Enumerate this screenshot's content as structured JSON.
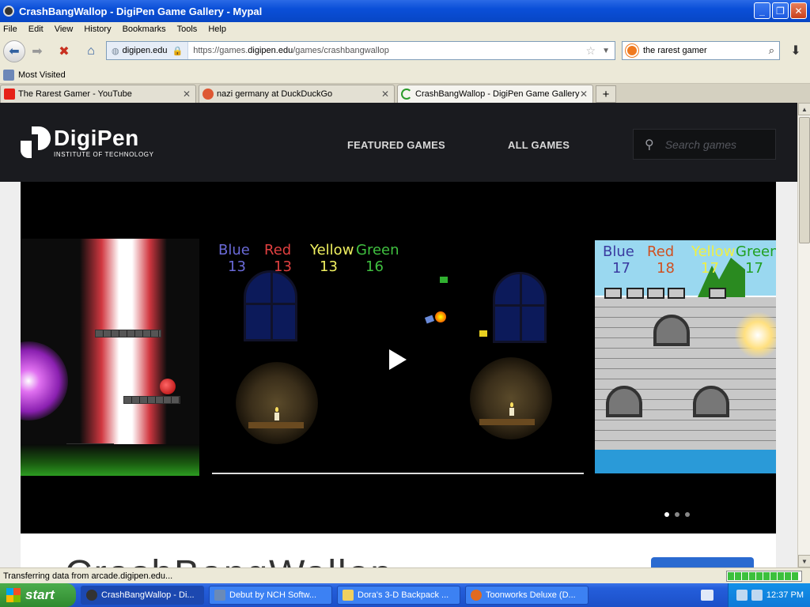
{
  "window": {
    "title": "CrashBangWallop - DigiPen Game Gallery - Mypal"
  },
  "menu": [
    "File",
    "Edit",
    "View",
    "History",
    "Bookmarks",
    "Tools",
    "Help"
  ],
  "nav": {
    "site": "digipen.edu",
    "url_prefix": "https://games.",
    "url_domain": "digipen.edu",
    "url_path": "/games/crashbangwallop",
    "search_value": "the rarest gamer"
  },
  "bookmarks": {
    "most_visited": "Most Visited"
  },
  "tabs": [
    {
      "label": "The Rarest Gamer - YouTube",
      "icon_color": "#e62117"
    },
    {
      "label": "nazi germany at DuckDuckGo",
      "icon_color": "#de5833"
    },
    {
      "label": "CrashBangWallop - DigiPen Game Gallery",
      "icon_color": "#2a9a2a"
    }
  ],
  "site": {
    "logo_main": "DigiPen",
    "logo_sub": "INSTITUTE OF TECHNOLOGY",
    "nav_featured": "FEATURED GAMES",
    "nav_all": "ALL GAMES",
    "search_placeholder": "Search games",
    "page_title": "CrashBangWallop"
  },
  "game_scores": [
    {
      "team": "Blue",
      "value": "13",
      "color": "#6a6ad8"
    },
    {
      "team": "Red",
      "value": "13",
      "color": "#e04040"
    },
    {
      "team": "Yellow",
      "value": "13",
      "color": "#f0f060"
    },
    {
      "team": "Green",
      "value": "16",
      "color": "#40c040"
    }
  ],
  "game_scores_right": [
    {
      "team": "Blue",
      "value": "17",
      "color": "#3a3aa0"
    },
    {
      "team": "Red",
      "value": "18",
      "color": "#d05020"
    },
    {
      "team": "Yellow",
      "value": "17",
      "color": "#f0f040"
    },
    {
      "team": "Green",
      "value": "17",
      "color": "#20a020"
    }
  ],
  "carousel": {
    "active_dot": 0,
    "dot_count": 3
  },
  "status": {
    "text": "Transferring data from arcade.digipen.edu..."
  },
  "taskbar": {
    "start": "start",
    "tasks": [
      {
        "label": "CrashBangWallop - Di...",
        "icon_color": "#333"
      },
      {
        "label": "Debut by NCH Softw...",
        "icon_color": "#6a8ab8"
      },
      {
        "label": "Dora's 3-D Backpack ...",
        "icon_color": "#f0d060"
      },
      {
        "label": "Toonworks Deluxe (D...",
        "icon_color": "#e06a20"
      }
    ],
    "clock": "12:37 PM"
  }
}
